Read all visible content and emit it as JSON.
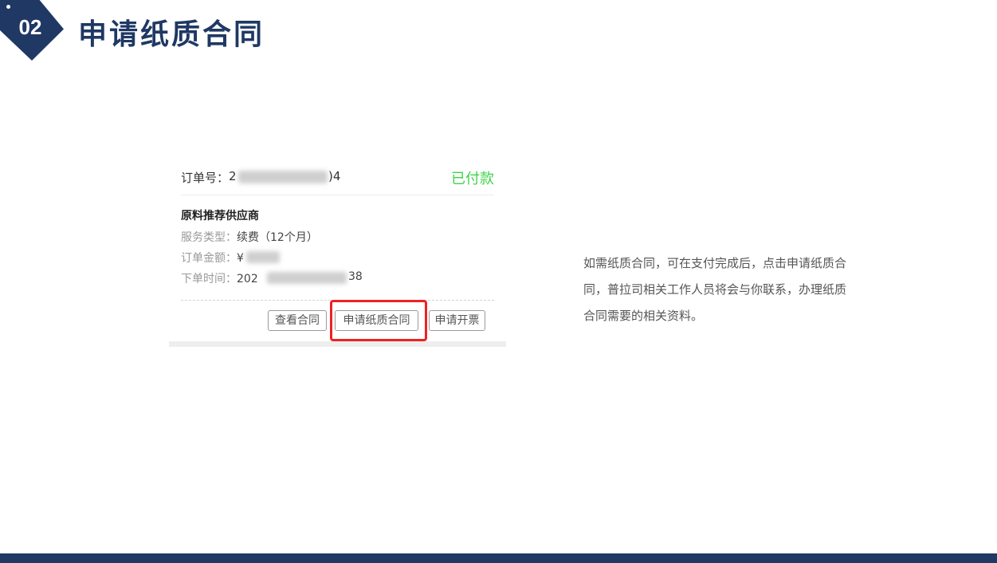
{
  "header": {
    "step_number": "02",
    "title": "申请纸质合同"
  },
  "order_card": {
    "order_label": "订单号：",
    "order_number_visible_prefix": "2",
    "order_number_visible_suffix": ")4",
    "status": "已付款",
    "supplier_name": "原料推荐供应商",
    "service_type_label": "服务类型：",
    "service_type_value": "续费（12个月）",
    "amount_label": "订单金额：",
    "amount_visible": "¥",
    "order_time_label": "下单时间：",
    "order_time_visible_prefix": "202",
    "order_time_visible_suffix": "38",
    "buttons": {
      "view_contract": "查看合同",
      "apply_paper_contract": "申请纸质合同",
      "apply_invoice": "申请开票"
    }
  },
  "description": "如需纸质合同，可在支付完成后，点击申请纸质合同，普拉司相关工作人员将会与你联系，办理纸质合同需要的相关资料。",
  "colors": {
    "brand_navy": "#1f3864",
    "status_green": "#3fd34a",
    "highlight_red": "#ee2222"
  }
}
